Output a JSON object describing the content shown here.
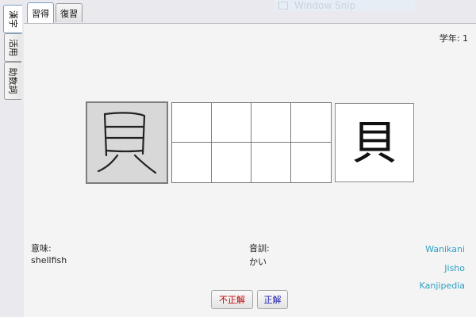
{
  "side_tabs": [
    "漢字",
    "活用",
    "助数詞"
  ],
  "top_tabs": [
    "習得",
    "復習"
  ],
  "overlay": {
    "title": "Window Snip"
  },
  "grade": "学年: 1",
  "kanji": "貝",
  "meaning": {
    "label": "意味:",
    "value": "shellfish"
  },
  "reading": {
    "label": "音訓:",
    "value": "かい"
  },
  "links": [
    "Wanikani",
    "Jisho",
    "Kanjipedia"
  ],
  "buttons": {
    "incorrect": "不正解",
    "correct": "正解"
  },
  "colors": {
    "incorrect": "#c00000",
    "correct": "#1a1ab0",
    "link": "#2f9fc4"
  }
}
